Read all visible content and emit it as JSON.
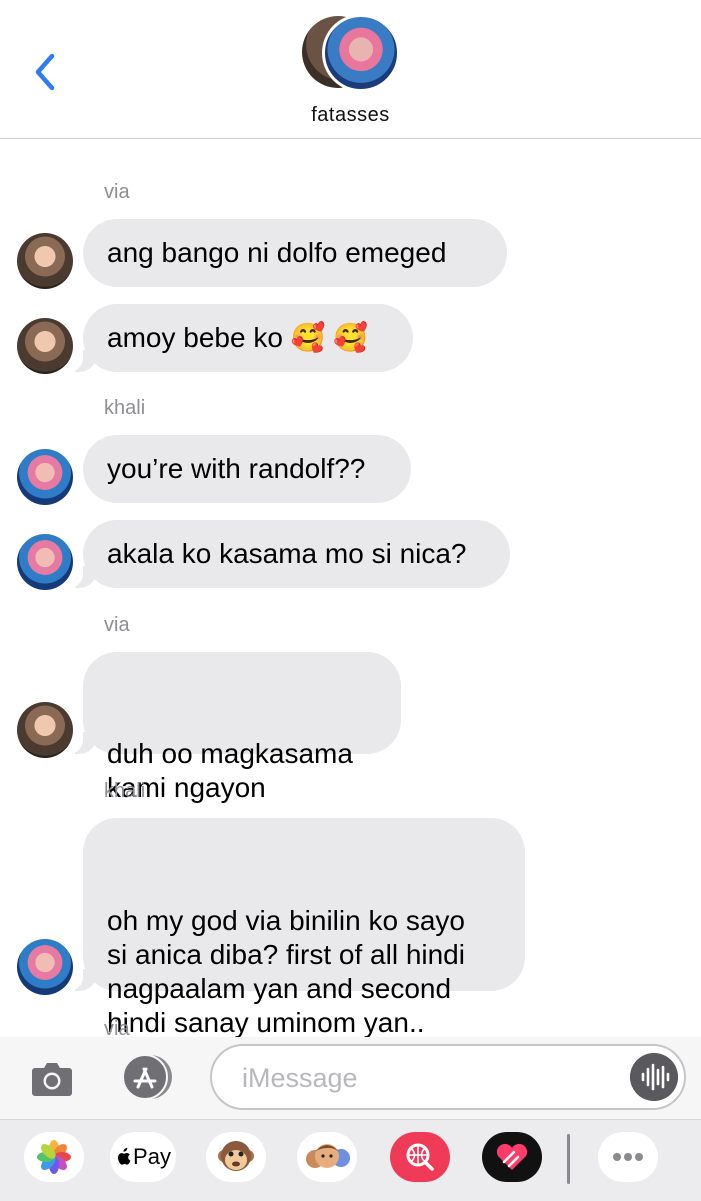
{
  "header": {
    "group_name": "fatasses"
  },
  "messages": [
    {
      "sender": "via",
      "text": "ang bango ni dolfo emeged",
      "author": "via"
    },
    {
      "text": "amoy bebe ko 🥰 🥰",
      "author": "via"
    },
    {
      "sender": "khali",
      "text": "you’re with randolf??",
      "author": "khali"
    },
    {
      "text": "akala ko kasama mo si nica?",
      "author": "khali"
    },
    {
      "sender": "via",
      "text": "duh oo magkasama\nkami ngayon",
      "author": "via"
    },
    {
      "sender": "khali",
      "text": "oh my god via binilin ko sayo\nsi anica diba? first of all hindi\nnagpaalam yan and second\nhindi sanay uminom yan..",
      "author": "khali"
    },
    {
      "sender": "via"
    }
  ],
  "compose": {
    "placeholder": "iMessage"
  },
  "tray": {
    "apple_pay_label": "Pay",
    "items": [
      "photos-icon",
      "apple-pay-icon",
      "monkey-animoji-icon",
      "memoji-icon",
      "search-images-icon",
      "digital-touch-icon",
      "more-icon"
    ]
  },
  "colors": {
    "accent": "#2f7bf5",
    "bubble_gray": "#e9e9eb",
    "sender_gray": "#8e8e93"
  }
}
